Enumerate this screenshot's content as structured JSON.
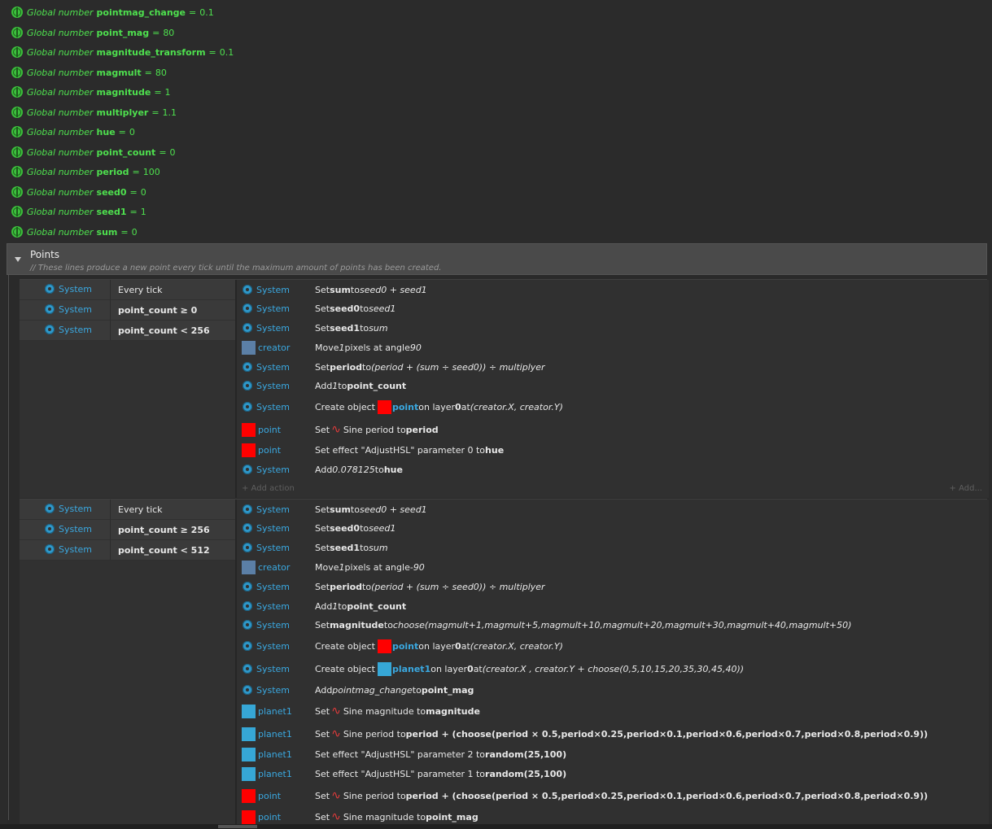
{
  "globals": [
    {
      "kw": "Global number",
      "name": "pointmag_change",
      "eq": "=",
      "value": "0.1"
    },
    {
      "kw": "Global number",
      "name": "point_mag",
      "eq": "=",
      "value": "80"
    },
    {
      "kw": "Global number",
      "name": "magnitude_transform",
      "eq": "=",
      "value": "0.1"
    },
    {
      "kw": "Global number",
      "name": "magmult",
      "eq": "=",
      "value": "80"
    },
    {
      "kw": "Global number",
      "name": "magnitude",
      "eq": "=",
      "value": "1"
    },
    {
      "kw": "Global number",
      "name": "multiplyer",
      "eq": "=",
      "value": "1.1"
    },
    {
      "kw": "Global number",
      "name": "hue",
      "eq": "=",
      "value": "0"
    },
    {
      "kw": "Global number",
      "name": "point_count",
      "eq": "=",
      "value": "0"
    },
    {
      "kw": "Global number",
      "name": "period",
      "eq": "=",
      "value": "100"
    },
    {
      "kw": "Global number",
      "name": "seed0",
      "eq": "=",
      "value": "0"
    },
    {
      "kw": "Global number",
      "name": "seed1",
      "eq": "=",
      "value": "1"
    },
    {
      "kw": "Global number",
      "name": "sum",
      "eq": "=",
      "value": "0"
    }
  ],
  "group": {
    "title": "Points",
    "comment": "//   These lines produce a new point every tick until the maximum amount of points has been created."
  },
  "objects": {
    "system": "System",
    "creator": "creator",
    "point": "point",
    "planet1": "planet1"
  },
  "colors": {
    "point": "#ff0000",
    "planet1": "#36a7d6",
    "creator": "#5b7fa6",
    "global": "#4ee04e",
    "object_link": "#3aa8e0"
  },
  "event1": {
    "conditions": [
      "Every tick",
      "point_count ≥ 0",
      "point_count < 256"
    ],
    "actions": [
      {
        "obj": "System",
        "pre": "Set ",
        "b1": "sum",
        "mid": " to ",
        "i1": "seed0 + seed1"
      },
      {
        "obj": "System",
        "pre": "Set ",
        "b1": "seed0",
        "mid": " to ",
        "i1": "seed1"
      },
      {
        "obj": "System",
        "pre": "Set ",
        "b1": "seed1",
        "mid": " to ",
        "i1": "sum"
      },
      {
        "obj": "creator",
        "pre": "Move ",
        "i1": "1",
        "mid": " pixels at angle ",
        "i2": "90"
      },
      {
        "obj": "System",
        "pre": "Set ",
        "b1": "period",
        "mid": " to ",
        "i1": "(period + (sum ÷ seed0)) ÷ multiplyer"
      },
      {
        "obj": "System",
        "pre": "Add ",
        "i1": "1",
        "mid": " to ",
        "b1": "point_count"
      },
      {
        "obj": "System",
        "pre": "Create object ",
        "link": "point",
        "mid": " on layer ",
        "b1": "0",
        "mid2": " at ",
        "i1": "(creator.X, creator.Y)"
      },
      {
        "obj": "point",
        "pre": "Set ",
        "sine": "∿",
        "mid": "Sine period to ",
        "b1": "period"
      },
      {
        "obj": "point",
        "pre": "Set effect \"AdjustHSL\" parameter 0 to ",
        "b1": "hue"
      },
      {
        "obj": "System",
        "pre": "Add ",
        "i1": "0.078125",
        "mid": " to ",
        "b1": "hue"
      }
    ],
    "add_action": "+ Add action",
    "add_more": "+ Add..."
  },
  "event2": {
    "conditions": [
      "Every tick",
      "point_count ≥ 256",
      "point_count < 512"
    ],
    "actions": [
      {
        "obj": "System",
        "pre": "Set ",
        "b1": "sum",
        "mid": " to ",
        "i1": "seed0 + seed1"
      },
      {
        "obj": "System",
        "pre": "Set ",
        "b1": "seed0",
        "mid": " to ",
        "i1": "seed1"
      },
      {
        "obj": "System",
        "pre": "Set ",
        "b1": "seed1",
        "mid": " to ",
        "i1": "sum"
      },
      {
        "obj": "creator",
        "pre": "Move ",
        "i1": "1",
        "mid": " pixels at angle ",
        "i2": "-90"
      },
      {
        "obj": "System",
        "pre": "Set ",
        "b1": "period",
        "mid": " to ",
        "i1": "(period + (sum ÷ seed0)) ÷ multiplyer"
      },
      {
        "obj": "System",
        "pre": "Add ",
        "i1": "1",
        "mid": " to ",
        "b1": "point_count"
      },
      {
        "obj": "System",
        "pre": "Set ",
        "b1": "magnitude",
        "mid": " to ",
        "i1": "choose(magmult+1,magmult+5,magmult+10,magmult+20,magmult+30,magmult+40,magmult+50)"
      },
      {
        "obj": "System",
        "pre": "Create object ",
        "link": "point",
        "mid": " on layer ",
        "b1": "0",
        "mid2": " at ",
        "i1": "(creator.X, creator.Y)"
      },
      {
        "obj": "System",
        "pre": "Create object ",
        "link": "planet1",
        "mid": " on layer ",
        "b1": "0",
        "mid2": " at ",
        "i1": "(creator.X , creator.Y + choose(0,5,10,15,20,35,30,45,40))"
      },
      {
        "obj": "System",
        "pre": "Add ",
        "i1": "pointmag_change",
        "mid": " to ",
        "b1": "point_mag"
      },
      {
        "obj": "planet1",
        "pre": "Set ",
        "sine": "∿",
        "mid": "Sine magnitude to ",
        "b1": "magnitude"
      },
      {
        "obj": "planet1",
        "pre": "Set ",
        "sine": "∿",
        "mid": "Sine period to ",
        "b1": "period + (choose(period × 0.5,period×0.25,period×0.1,period×0.6,period×0.7,period×0.8,period×0.9))"
      },
      {
        "obj": "planet1",
        "pre": "Set effect \"AdjustHSL\" parameter 2 to ",
        "b1": "random(25,100)"
      },
      {
        "obj": "planet1",
        "pre": "Set effect \"AdjustHSL\" parameter 1 to ",
        "b1": "random(25,100)"
      },
      {
        "obj": "point",
        "pre": "Set ",
        "sine": "∿",
        "mid": "Sine period to ",
        "b1": "period + (choose(period × 0.5,period×0.25,period×0.1,period×0.6,period×0.7,period×0.8,period×0.9))"
      },
      {
        "obj": "point",
        "pre": "Set ",
        "sine": "∿",
        "mid": "Sine magnitude to ",
        "b1": "point_mag"
      }
    ]
  }
}
